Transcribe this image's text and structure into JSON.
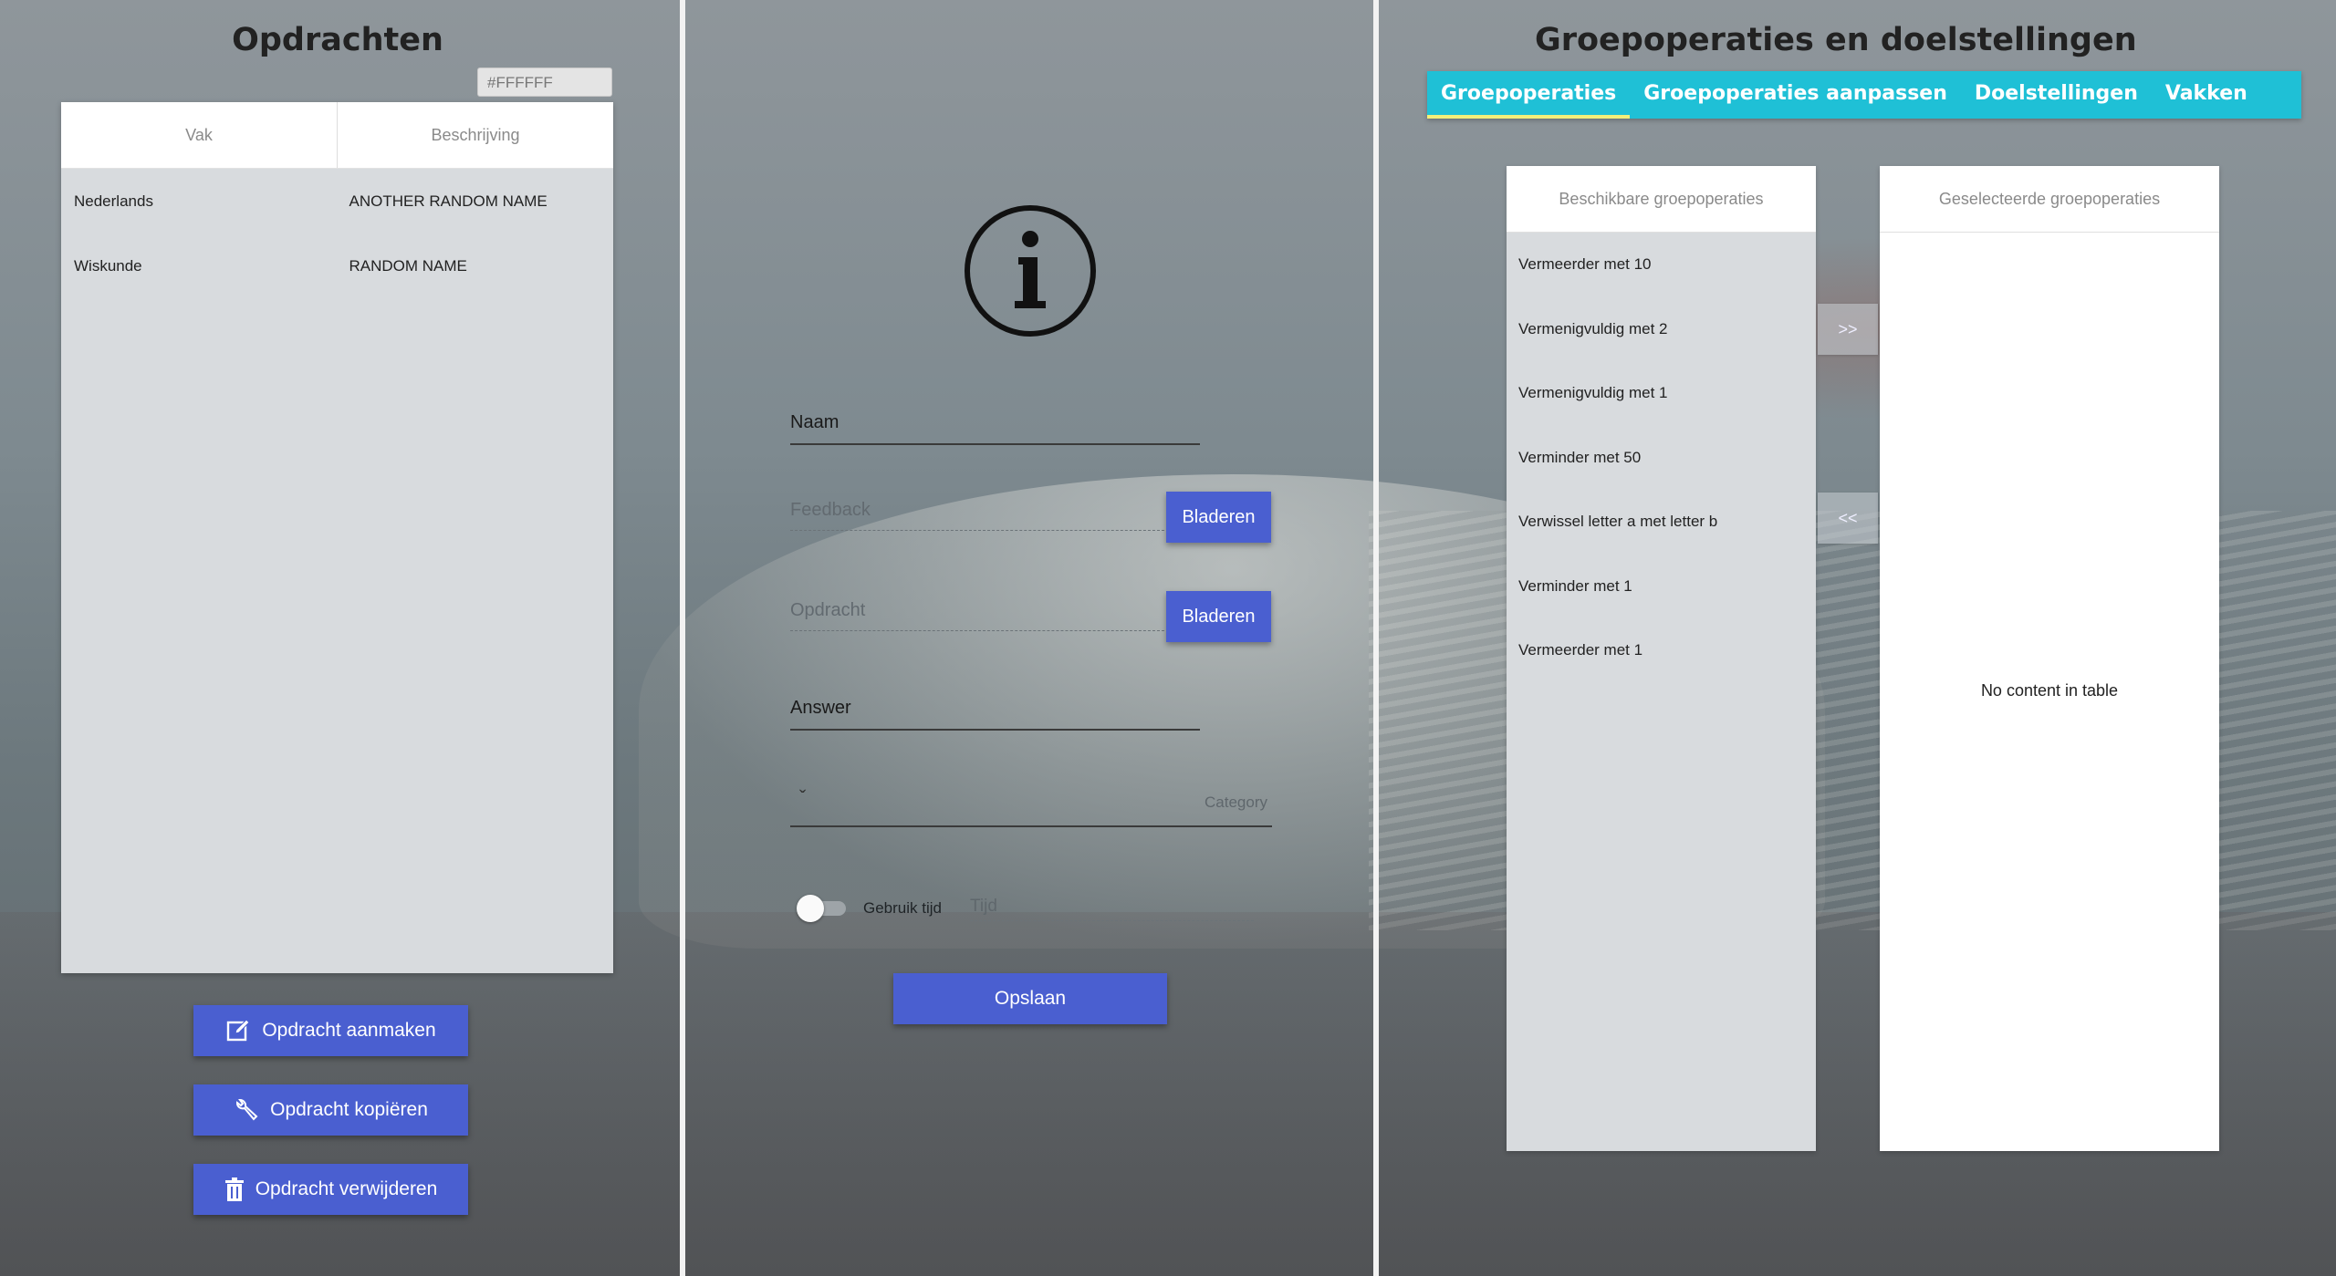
{
  "left": {
    "title": "Opdrachten",
    "color_value": "#FFFFFF",
    "table": {
      "headers": [
        "Vak",
        "Beschrijving"
      ],
      "rows": [
        [
          "Nederlands",
          "ANOTHER RANDOM NAME"
        ],
        [
          "Wiskunde",
          "RANDOM NAME"
        ]
      ]
    },
    "buttons": {
      "create": "Opdracht aanmaken",
      "copy": "Opdracht kopiëren",
      "delete": "Opdracht verwijderen"
    },
    "colors": {
      "button": "#4a5fd0"
    }
  },
  "middle": {
    "fields": {
      "naam": "Naam",
      "feedback": "Feedback",
      "opdracht": "Opdracht",
      "answer": "Answer",
      "category": "Category",
      "use_time": "Gebruik tijd",
      "tijd": "Tijd"
    },
    "browse_label": "Bladeren",
    "save_label": "Opslaan",
    "dropdown_caret": "ˇ",
    "info_icon": "info-icon",
    "use_time_enabled": false
  },
  "right": {
    "title": "Groepoperaties en doelstellingen",
    "tabs": [
      "Groepoperaties",
      "Groepoperaties aanpassen",
      "Doelstellingen",
      "Vakken"
    ],
    "active_tab": "Groepoperaties",
    "available_header": "Beschikbare groepoperaties",
    "selected_header": "Geselecteerde groepoperaties",
    "available_items": [
      "Vermeerder met 10",
      "Vermenigvuldig met 2",
      "Vermenigvuldig met 1",
      "Verminder met 50",
      "Verwissel letter a met letter b",
      "Verminder met 1",
      "Vermeerder met 1"
    ],
    "empty_text": "No content in table",
    "move_right": ">>",
    "move_left": "<<",
    "colors": {
      "tabbar": "#1fc0d6",
      "active_underline": "#f3ef7a"
    }
  }
}
